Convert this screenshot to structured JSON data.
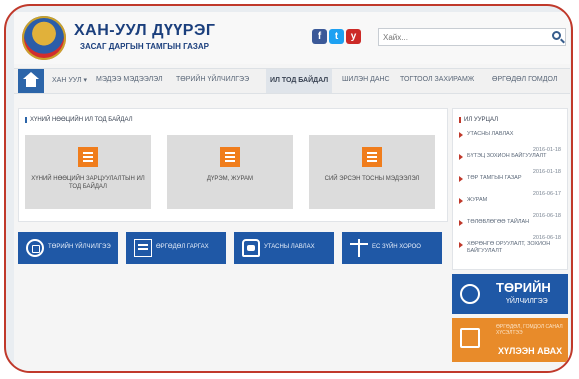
{
  "header": {
    "title": "ХАН-УУЛ ДҮҮРЭГ",
    "subtitle": "ЗАСАГ ДАРГЫН ТАМГЫН ГАЗАР",
    "search_placeholder": "Хайх...",
    "social": [
      "f",
      "t",
      "y"
    ]
  },
  "nav": {
    "items": [
      "ХАН УУЛ ▾",
      "МЭДЭЭ МЭДЭЭЛЭЛ",
      "ТӨРИЙН ҮЙЛЧИЛГЭЭ",
      "ИЛ ТОД БАЙДАЛ",
      "ШИЛЭН ДАНС",
      "ТОГТООЛ ЗАХИРАМЖ",
      "ӨРГӨДӨЛ ГОМДОЛ"
    ],
    "active_index": 3
  },
  "main": {
    "section_title": "ХҮНИЙ НӨӨЦИЙН ИЛ ТОД БАЙДАЛ",
    "tiles": [
      "ХҮНИЙ НӨӨЦИЙН ЗАРЦУУЛАЛТЫН ИЛ ТОД БАЙДАЛ",
      "ДҮРЭМ, ЖУРАМ",
      "СИЙ ЭРСЭН ТОСНЫ МЭДЭЭЛЭЛ"
    ]
  },
  "quick_links": [
    {
      "label": "ТӨРИЙН ҮЙЛЧИЛГЭЭ",
      "icon": "building-icon"
    },
    {
      "label": "ӨРГӨДӨЛ ГАРГАХ",
      "icon": "document-icon"
    },
    {
      "label": "УТАСНЫ ЛАВЛАХ",
      "icon": "phone-icon"
    },
    {
      "label": "ЕС ЗҮЙН ХОРОО",
      "icon": "scales-icon"
    }
  ],
  "sidebar": {
    "title": "ИЛ УУРЦАЛ",
    "news": [
      {
        "title": "УТАСНЫ ЛАВЛАХ",
        "date": "2016-01-18"
      },
      {
        "title": "БҮТЭЦ ЗОХИОН БАЙГУУЛАЛТ",
        "date": "2016-01-18"
      },
      {
        "title": "ТӨР ТАМГЫН ГАЗАР",
        "date": "2016-06-17"
      },
      {
        "title": "ЖУРАМ",
        "date": "2016-06-18"
      },
      {
        "title": "ТӨЛӨВЛӨГӨӨ ТАЙЛАН",
        "date": "2016-06-18"
      },
      {
        "title": "ХӨРӨНГӨ ОРУУЛАЛТ, ЗОХИОН БАЙГУУЛАЛТ",
        "date": ""
      }
    ]
  },
  "promos": {
    "blue_title": "ТӨРИЙН",
    "blue_sub": "ҮЙЛЧИЛГЭЭ",
    "orange_small": "ӨРГӨДӨЛ, ГОМДОЛ САНАЛ ХҮСЭЛТЭЭ",
    "orange_title": "ХҮЛЭЭН АВАХ"
  },
  "colors": {
    "frame": "#c0392b",
    "brand_blue": "#1f58a6",
    "accent_orange": "#f07d1c"
  }
}
